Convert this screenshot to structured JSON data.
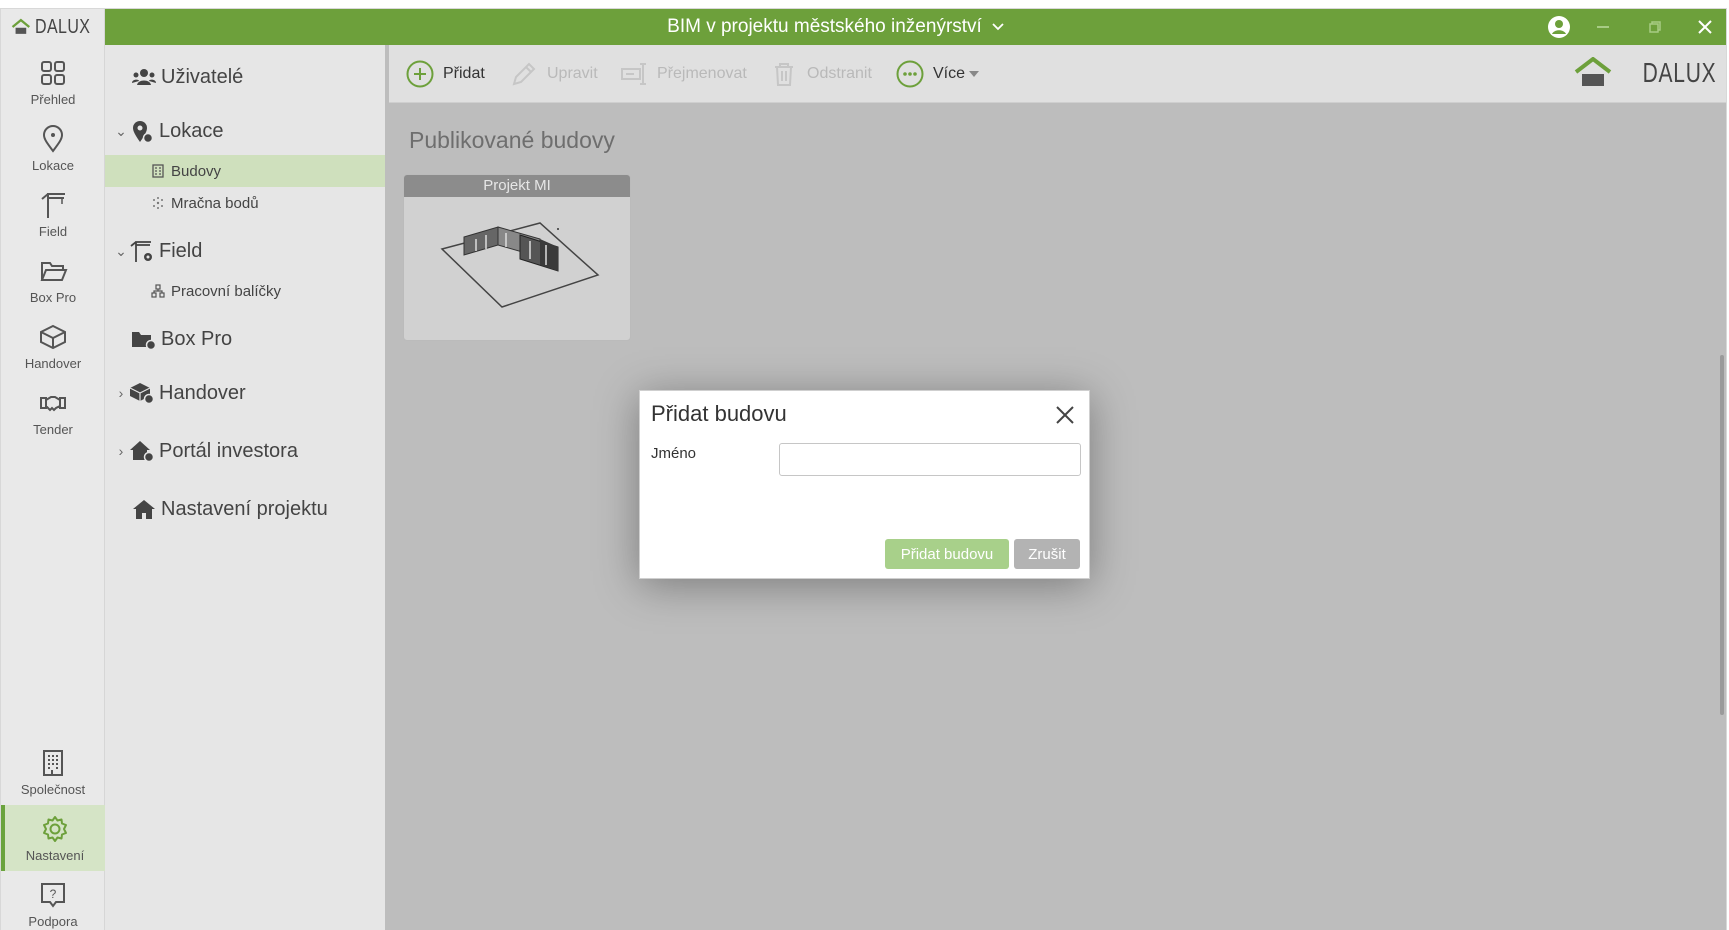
{
  "window": {
    "title": "BIM v projektu městského inženýrství",
    "logo_text": "DALUX"
  },
  "rail": {
    "items": [
      {
        "label": "Přehled",
        "icon": "grid-icon"
      },
      {
        "label": "Lokace",
        "icon": "map-pin-icon"
      },
      {
        "label": "Field",
        "icon": "crane-icon"
      },
      {
        "label": "Box Pro",
        "icon": "folder-open-icon"
      },
      {
        "label": "Handover",
        "icon": "box-icon"
      },
      {
        "label": "Tender",
        "icon": "handshake-icon"
      },
      {
        "label": "Společnost",
        "icon": "building-icon"
      },
      {
        "label": "Nastavení",
        "icon": "gear-icon",
        "active": true
      },
      {
        "label": "Podpora",
        "icon": "help-icon"
      }
    ]
  },
  "nav": {
    "users": "Uživatelé",
    "locations": "Lokace",
    "buildings": "Budovy",
    "point_clouds": "Mračna bodů",
    "field": "Field",
    "work_packages": "Pracovní balíčky",
    "box_pro": "Box Pro",
    "handover": "Handover",
    "investor_portal": "Portál investora",
    "project_settings": "Nastavení projektu"
  },
  "toolbar": {
    "add": "Přidat",
    "edit": "Upravit",
    "rename": "Přejmenovat",
    "delete": "Odstranit",
    "more": "Více"
  },
  "brand": "DALUX",
  "main": {
    "section_title": "Publikované budovy",
    "cards": [
      {
        "title": "Projekt MI"
      }
    ]
  },
  "dialog": {
    "title": "Přidat budovu",
    "name_label": "Jméno",
    "name_value": "",
    "submit": "Přidat budovu",
    "cancel": "Zrušit"
  },
  "colors": {
    "accent": "#6da03b",
    "active_nav": "#cfe0bd",
    "primary_button": "#a8d08a"
  }
}
